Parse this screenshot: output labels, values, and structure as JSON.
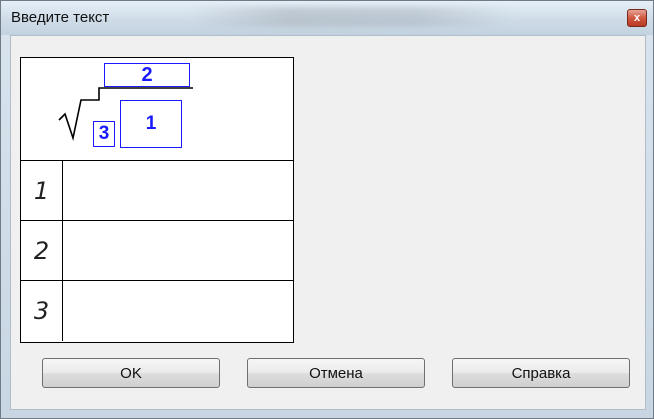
{
  "window": {
    "title": "Введите текст",
    "close_glyph": "x"
  },
  "formula": {
    "exponent": "2",
    "radical_index": "3",
    "radicand": "1"
  },
  "rows": [
    {
      "label": "1",
      "value": ""
    },
    {
      "label": "2",
      "value": ""
    },
    {
      "label": "3",
      "value": ""
    }
  ],
  "buttons": {
    "ok": "OK",
    "cancel": "Отмена",
    "help": "Справка"
  },
  "colors": {
    "field_blue": "#1a1aff",
    "title_bar": "#cfdce8",
    "close_red": "#d0583f"
  }
}
